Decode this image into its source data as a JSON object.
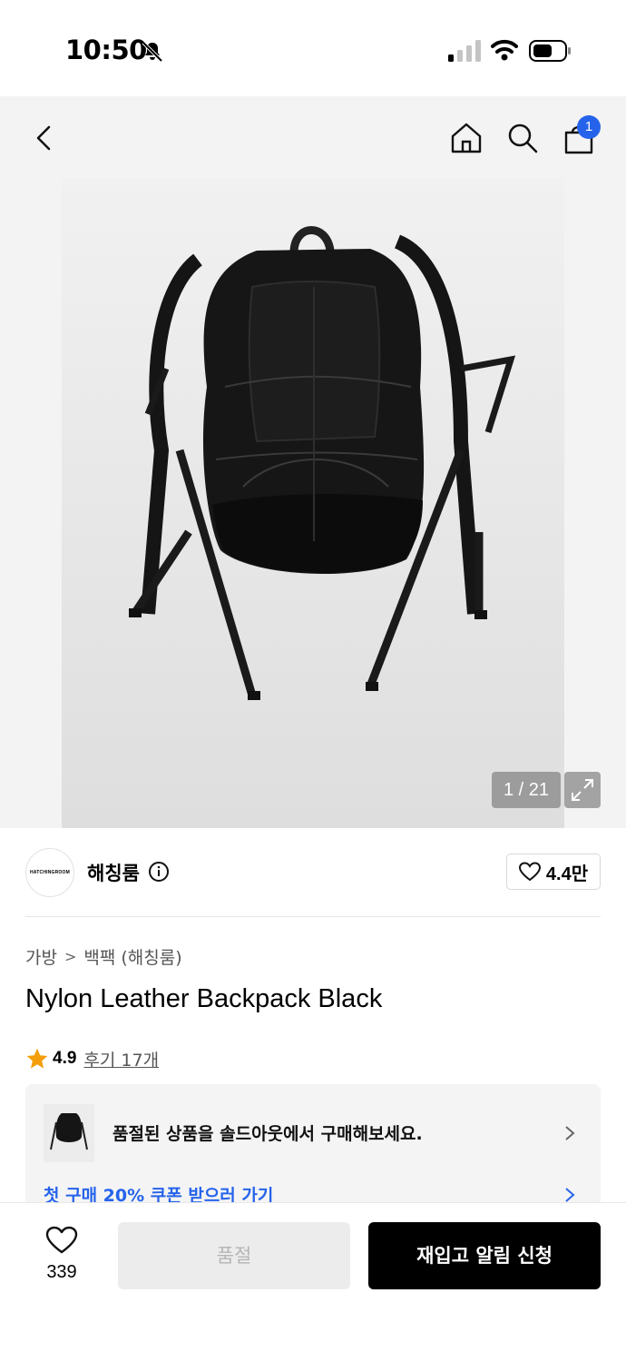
{
  "status_bar": {
    "time": "10:50"
  },
  "gallery": {
    "counter": "1 / 21",
    "cart_count": "1"
  },
  "brand": {
    "logo_text": "HATCHINGROOM",
    "name": "해칭룸",
    "like_count": "4.4만"
  },
  "breadcrumb": {
    "category": "가방",
    "subcategory": "백팩 (해칭룸)"
  },
  "product": {
    "title": "Nylon Leather Backpack Black",
    "rating": "4.9",
    "review_label": "후기 17개"
  },
  "notice": {
    "soldout_text": "품절된 상품을 솔드아웃에서 구매해보세요.",
    "coupon_text": "첫 구매 20% 쿠폰 받으러 가기"
  },
  "bottom_bar": {
    "wish_count": "339",
    "soldout_label": "품절",
    "restock_label": "재입고 알림 신청"
  },
  "colors": {
    "accent": "#2563eb",
    "star": "#f59e0b",
    "primary_button": "#000000",
    "disabled_button": "#ececec"
  }
}
